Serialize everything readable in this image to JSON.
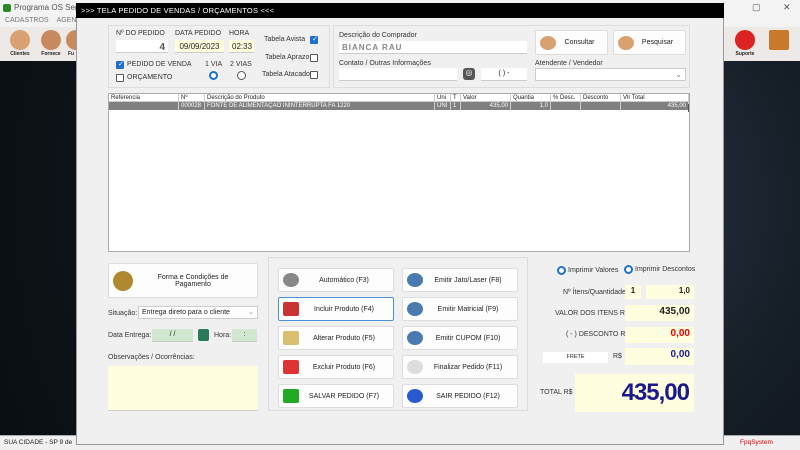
{
  "app": {
    "title": "Programa OS Segur",
    "menu": [
      "CADASTROS",
      "AGEND"
    ],
    "toolbar": [
      "Clientes",
      "Fornece",
      "Fu"
    ],
    "right_toolbar": [
      "Suporte"
    ],
    "status": {
      "city": "SUA CIDADE - SP  9 de",
      "brand": "FpqSystem"
    }
  },
  "dialog": {
    "title": ">>>   TELA PEDIDO DE VENDAS / ORÇAMENTOS   <<<"
  },
  "order": {
    "number_label": "Nº DO PEDIDO",
    "number": "4",
    "date_label": "DATA PEDIDO",
    "date": "09/09/2023",
    "time_label": "HORA",
    "time": "02:33",
    "pedido_venda": {
      "label": "PEDIDO DE VENDA",
      "checked": true
    },
    "orcamento": {
      "label": "ORÇAMENTO",
      "checked": false
    },
    "via1": {
      "label": "1 VIA",
      "selected": true
    },
    "via2": {
      "label": "2 VIAS",
      "selected": false
    },
    "tables": [
      {
        "label": "Tabela Avista",
        "checked": true
      },
      {
        "label": "Tabela Aprazo",
        "checked": false
      },
      {
        "label": "Tabela Atacado",
        "checked": false
      }
    ]
  },
  "buyer": {
    "desc_label": "Descrição do Comprador",
    "name": "BIANCA RAU",
    "consultar": "Consultar",
    "pesquisar": "Pesquisar",
    "contact_label": "Contato / Outras Informações",
    "contact": "",
    "phone": "(  )     -",
    "seller_label": "Atendente / Vendedor",
    "seller": ""
  },
  "items": {
    "columns": [
      "Referencia",
      "Nº",
      "Descrição do Produto",
      "Uni",
      "T",
      "Valor",
      "Quantia",
      "% Desc.",
      "Desconto",
      "Vlr Total"
    ],
    "rows": [
      [
        "",
        "000028",
        "FONTE DE ALIMENTAÇÃO ININTERRUPTA FA 1220",
        "UNI",
        "1",
        "435,00",
        "1,0",
        "",
        "",
        "435,00"
      ]
    ]
  },
  "left": {
    "payment": "Forma e Condições de Pagamento",
    "situacao_label": "Situação:",
    "situacao": "Entrega direto para o cliente",
    "data_entrega_label": "Data Entrega:",
    "data_entrega": "/  /",
    "hora_label": "Hora:",
    "hora": ":",
    "obs_label": "Observações / Ocorrências:",
    "obs": ""
  },
  "actions": [
    "Automático     (F3)",
    "Emitir Jato/Laser (F8)",
    "Incluir Produto  (F4)",
    "Emitir Matricial   (F9)",
    "Alterar Produto  (F5)",
    "Emitir CUPOM   (F10)",
    "Excluir Produto  (F6)",
    "Finalizar Pedido  (F11)",
    "SALVAR PEDIDO (F7)",
    "SAIR  PEDIDO  (F12)"
  ],
  "totals": {
    "print_values": {
      "label": "Imprimir Valores",
      "selected": true
    },
    "print_discounts": {
      "label": "Imprimir Descontos",
      "selected": true
    },
    "items_label": "Nº Ítens/Quantidade",
    "items_count": "1",
    "quantity": "1,0",
    "valor_label": "VALOR DOS ITENS R$",
    "valor": "435,00",
    "desconto_label": "( - ) DESCONTO R$",
    "desconto": "0,00",
    "frete_button": "FRETE",
    "frete_label": "R$",
    "frete": "0,00",
    "total_label": "TOTAL R$",
    "total": "435,00",
    "colors": {
      "discount": "#e00000",
      "total": "#1a1a8c"
    }
  }
}
